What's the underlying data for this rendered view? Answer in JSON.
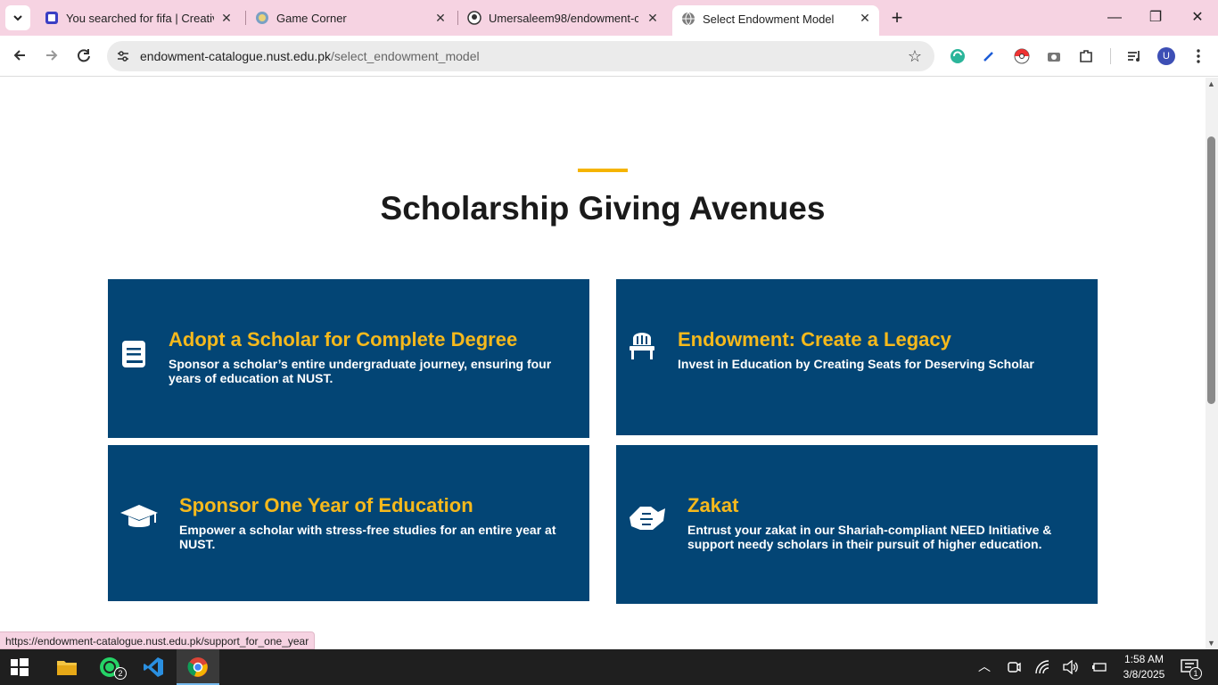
{
  "tabs": [
    {
      "title": "You searched for fifa | Creative (",
      "close": "✕"
    },
    {
      "title": "Game Corner",
      "close": "✕"
    },
    {
      "title": "Umersaleem98/endowment-cat",
      "close": "✕"
    },
    {
      "title": "Select Endowment Model",
      "close": "✕"
    }
  ],
  "new_tab": "+",
  "window_controls": {
    "minimize": "—",
    "maximize": "❐",
    "close": "✕"
  },
  "address_bar": {
    "domain": "endowment-catalogue.nust.edu.pk",
    "path": "/select_endowment_model"
  },
  "page": {
    "title": "Scholarship Giving Avenues",
    "cards": [
      {
        "title": "Adopt a Scholar for Complete Degree",
        "description": "Sponsor a scholar’s entire undergraduate journey, ensuring four years of education at NUST.",
        "icon": "book-icon"
      },
      {
        "title": "Endowment: Create a Legacy",
        "description": "Invest in Education by Creating Seats for Deserving Scholar",
        "icon": "chair-icon"
      },
      {
        "title": "Sponsor One Year of Education",
        "description": "Empower a scholar with stress-free studies for an entire year at NUST.",
        "icon": "graduation-cap-icon"
      },
      {
        "title": "Zakat",
        "description": "Entrust your zakat in our Shariah-compliant NEED Initiative & support needy scholars in their pursuit of higher education.",
        "icon": "handshake-icon"
      }
    ]
  },
  "status_url": "https://endowment-catalogue.nust.edu.pk/support_for_one_year",
  "taskbar": {
    "whatsapp_badge": "2",
    "notification_badge": "1"
  },
  "clock": {
    "time": "1:58 AM",
    "date": "3/8/2025"
  },
  "colors": {
    "card_bg": "#034575",
    "card_title": "#f6b91c",
    "accent": "#f5b400",
    "tabstrip": "#f6d3e2"
  }
}
